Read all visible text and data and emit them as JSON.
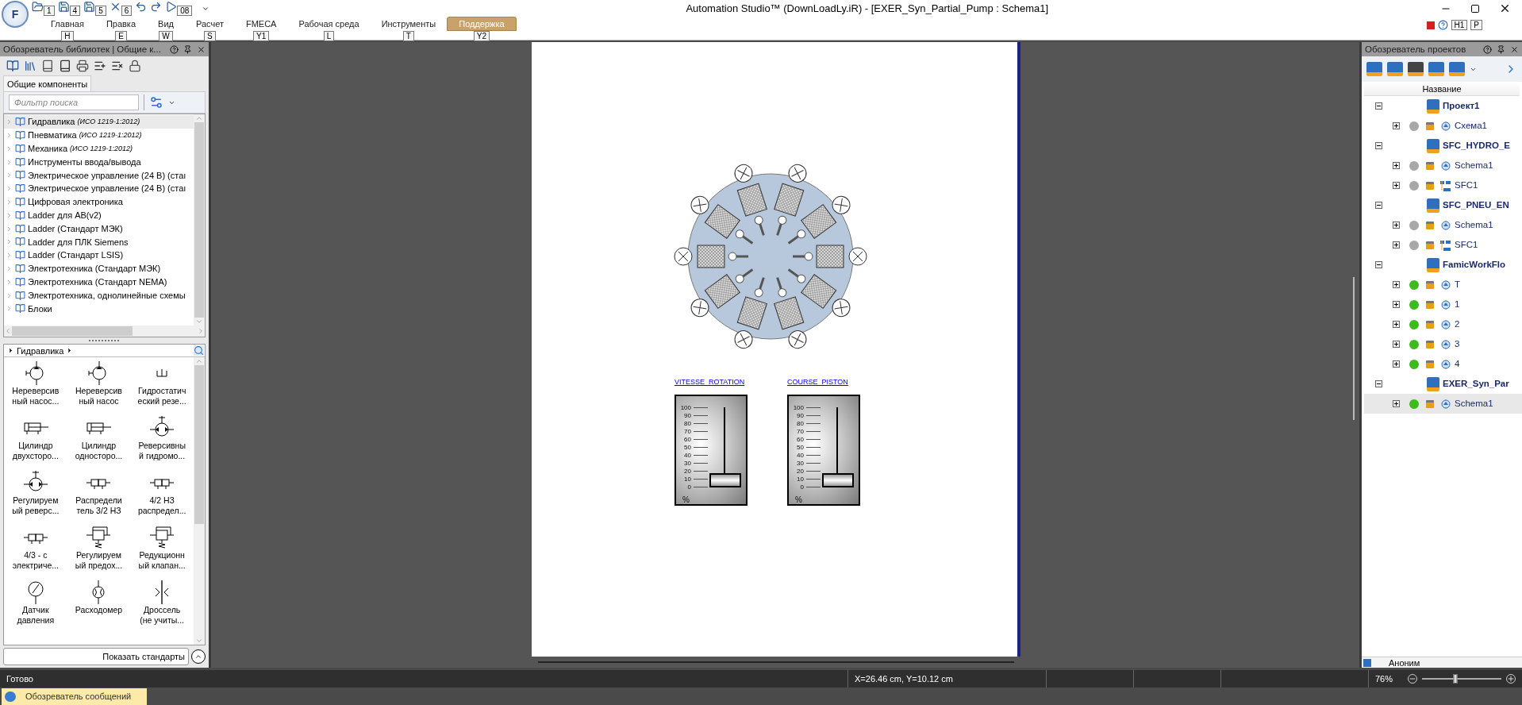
{
  "app_button": "F",
  "quick_access": [
    {
      "kind": "open",
      "keytip": "1"
    },
    {
      "kind": "save",
      "keytip": "4"
    },
    {
      "kind": "save",
      "keytip": "5"
    },
    {
      "kind": "close",
      "keytip": "6"
    },
    {
      "kind": "undo"
    },
    {
      "kind": "redo"
    },
    {
      "kind": "run",
      "keytip": "08"
    }
  ],
  "window": {
    "title": "Automation Studio™ (DownLoadLy.iR) - [EXER_Syn_Partial_Pump : Schema1]"
  },
  "ribbon_tabs": [
    {
      "label": "Главная",
      "keytip": "H",
      "selected": false
    },
    {
      "label": "Правка",
      "keytip": "E",
      "selected": false
    },
    {
      "label": "Вид",
      "keytip": "W",
      "selected": false
    },
    {
      "label": "Расчет",
      "keytip": "S",
      "selected": false
    },
    {
      "label": "FMECA",
      "keytip": "Y1",
      "selected": false
    },
    {
      "label": "Рабочая среда",
      "keytip": "L",
      "selected": false
    },
    {
      "label": "Инструменты",
      "keytip": "T",
      "selected": false
    },
    {
      "label": "Поддержка",
      "keytip": "Y2",
      "selected": true
    }
  ],
  "ribbon_right_keytips": [
    "H1",
    "P"
  ],
  "library_panel": {
    "title": "Обозреватель библиотек | Общие к...",
    "tab": "Общие компоненты",
    "search": {
      "placeholder": "Фильтр поиска"
    },
    "tree": [
      {
        "label": "Гидравлика",
        "note": "(ИСО 1219-1:2012)",
        "selected": true
      },
      {
        "label": "Пневматика",
        "note": "(ИСО 1219-1:2012)",
        "selected": false
      },
      {
        "label": "Механика",
        "note": "(ИСО 1219-1:2012)",
        "selected": false
      },
      {
        "label": "Инструменты ввода/вывода",
        "selected": false
      },
      {
        "label": "Электрическое управление (24 В) (стаı",
        "selected": false
      },
      {
        "label": "Электрическое управление (24 В) (стаı",
        "selected": false
      },
      {
        "label": "Цифровая электроника",
        "selected": false
      },
      {
        "label": "Ladder для AB(v2)",
        "selected": false
      },
      {
        "label": "Ladder (Стандарт МЭК)",
        "selected": false
      },
      {
        "label": "Ladder для ПЛК Siemens",
        "selected": false
      },
      {
        "label": "Ladder (Стандарт LSIS)",
        "selected": false
      },
      {
        "label": "Электротехника (Стандарт МЭК)",
        "selected": false
      },
      {
        "label": "Электротехника (Стандарт NEMA)",
        "selected": false
      },
      {
        "label": "Электротехника, однолинейные схемы",
        "selected": false
      },
      {
        "label": "Блоки",
        "selected": false
      }
    ],
    "breadcrumb": "Гидравлика",
    "components": [
      {
        "kind": "pump",
        "lines": [
          "Нереверсив",
          "ный насос..."
        ]
      },
      {
        "kind": "pump",
        "lines": [
          "Нереверсив",
          "ный насос"
        ]
      },
      {
        "kind": "reservoir",
        "lines": [
          "Гидростатич",
          "еский резе..."
        ]
      },
      {
        "kind": "cylinder",
        "lines": [
          "Цилиндр",
          "двухсторо..."
        ]
      },
      {
        "kind": "cylinder",
        "lines": [
          "Цилиндр",
          "односторо..."
        ]
      },
      {
        "kind": "motor",
        "lines": [
          "Реверсивны",
          "й гидромо..."
        ]
      },
      {
        "kind": "motor",
        "lines": [
          "Регулируем",
          "ый реверс..."
        ]
      },
      {
        "kind": "valve",
        "lines": [
          "Распредели",
          "тель 3/2 НЗ"
        ]
      },
      {
        "kind": "valve",
        "lines": [
          "4/2 НЗ",
          "распредел..."
        ]
      },
      {
        "kind": "valve",
        "lines": [
          "4/3 - с",
          "электриче..."
        ]
      },
      {
        "kind": "relief",
        "lines": [
          "Регулируем",
          "ый предох..."
        ]
      },
      {
        "kind": "relief",
        "lines": [
          "Редукционн",
          "ый клапан..."
        ]
      },
      {
        "kind": "gauge",
        "lines": [
          "Датчик",
          "давления"
        ]
      },
      {
        "kind": "flowmeter",
        "lines": [
          "Расходомер"
        ]
      },
      {
        "kind": "throttle",
        "lines": [
          "Дроссель",
          "(не учиты..."
        ]
      }
    ],
    "show_standards": "Показать стандарты"
  },
  "canvas": {
    "sliders": [
      {
        "label": "VITESSE_ROTATION",
        "scale": [
          "100",
          "90",
          "80",
          "70",
          "60",
          "50",
          "40",
          "30",
          "20",
          "10",
          "0"
        ],
        "unit": "%",
        "level": 0
      },
      {
        "label": "COURSE_PISTON",
        "scale": [
          "100",
          "90",
          "80",
          "70",
          "60",
          "50",
          "40",
          "30",
          "20",
          "10",
          "0"
        ],
        "unit": "%",
        "level": 0
      }
    ]
  },
  "project_panel": {
    "title": "Обозреватель проектов",
    "column": "Название",
    "projects": [
      {
        "label": "Проект1",
        "expanded": true,
        "children": [
          {
            "label": "Схема1",
            "kind": "schema",
            "color": "#a8a8a8",
            "expanded": false,
            "selected": false
          }
        ]
      },
      {
        "label": "SFC_HYDRO_E",
        "expanded": true,
        "children": [
          {
            "label": "Schema1",
            "kind": "schema",
            "color": "#a8a8a8",
            "expanded": false,
            "selected": false
          },
          {
            "label": "SFC1",
            "kind": "sfc",
            "color": "#a8a8a8",
            "expanded": false,
            "selected": false
          }
        ]
      },
      {
        "label": "SFC_PNEU_EN",
        "expanded": true,
        "children": [
          {
            "label": "Schema1",
            "kind": "schema",
            "color": "#a8a8a8",
            "expanded": false,
            "selected": false
          },
          {
            "label": "SFC1",
            "kind": "sfc",
            "color": "#a8a8a8",
            "expanded": false,
            "selected": false
          }
        ]
      },
      {
        "label": "FamicWorkFlo",
        "expanded": true,
        "children": [
          {
            "label": "T",
            "kind": "schema",
            "color": "#3cba1e",
            "expanded": false,
            "selected": false
          },
          {
            "label": "1",
            "kind": "schema",
            "color": "#3cba1e",
            "expanded": false,
            "selected": false
          },
          {
            "label": "2",
            "kind": "schema",
            "color": "#3cba1e",
            "expanded": false,
            "selected": false
          },
          {
            "label": "3",
            "kind": "schema",
            "color": "#3cba1e",
            "expanded": false,
            "selected": false
          },
          {
            "label": "4",
            "kind": "schema",
            "color": "#3cba1e",
            "expanded": false,
            "selected": false
          }
        ]
      },
      {
        "label": "EXER_Syn_Par",
        "expanded": true,
        "children": [
          {
            "label": "Schema1",
            "kind": "schema",
            "color": "#3cba1e",
            "expanded": false,
            "selected": true
          }
        ]
      }
    ],
    "user": "Аноним"
  },
  "status_bar": {
    "message": "Готово",
    "coordinates": "X=26.46 cm, Y=10.12 cm",
    "zoom": "76%",
    "zoom_slider": {
      "level": 0.42
    }
  },
  "bottom_tabs": [
    {
      "label": "Обозреватель сообщений",
      "selected": true
    }
  ]
}
